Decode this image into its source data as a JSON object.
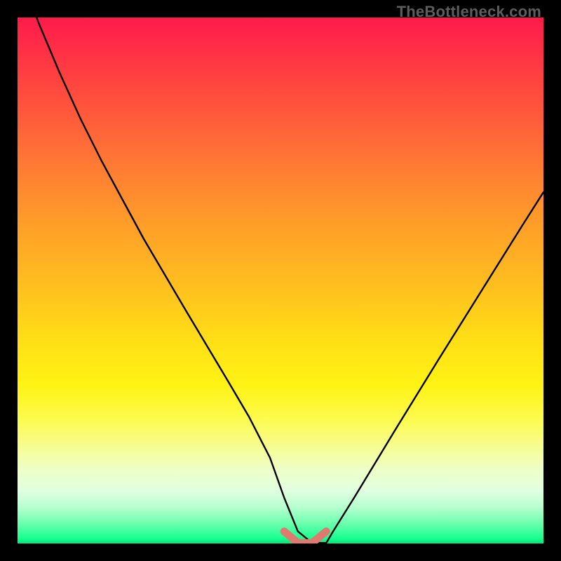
{
  "watermark": "TheBottleneck.com",
  "colors": {
    "background": "#000000",
    "curve": "#000000",
    "marker": "#e07a70",
    "gradient_top": "#ff1b4b",
    "gradient_mid": "#ffe016",
    "gradient_bottom": "#00e67a"
  },
  "chart_data": {
    "type": "line",
    "title": "",
    "xlabel": "",
    "ylabel": "",
    "xlim": [
      0,
      100
    ],
    "ylim": [
      0,
      100
    ],
    "grid": false,
    "legend": false,
    "series": [
      {
        "name": "bottleneck-curve",
        "x": [
          0,
          4,
          8,
          12,
          16,
          20,
          24,
          28,
          32,
          36,
          40,
          44,
          48,
          50.7,
          53.3,
          56,
          58.7,
          60,
          64,
          68,
          72,
          76,
          80,
          84,
          88,
          92,
          96,
          100
        ],
        "y": [
          110,
          99,
          89.5,
          80.7,
          72.7,
          65.3,
          57.9,
          51.1,
          44.3,
          37.6,
          30.9,
          24.1,
          16.3,
          8.7,
          2.3,
          0.1,
          0.1,
          2.3,
          8.7,
          15.3,
          21.9,
          28.4,
          34.9,
          41.3,
          47.7,
          54.1,
          60.5,
          66.8
        ]
      }
    ],
    "highlight_segment": {
      "name": "sweet-spot",
      "x": [
        50.7,
        53.3,
        56,
        58.7
      ],
      "y": [
        2.3,
        0.1,
        0.1,
        2.3
      ]
    }
  }
}
